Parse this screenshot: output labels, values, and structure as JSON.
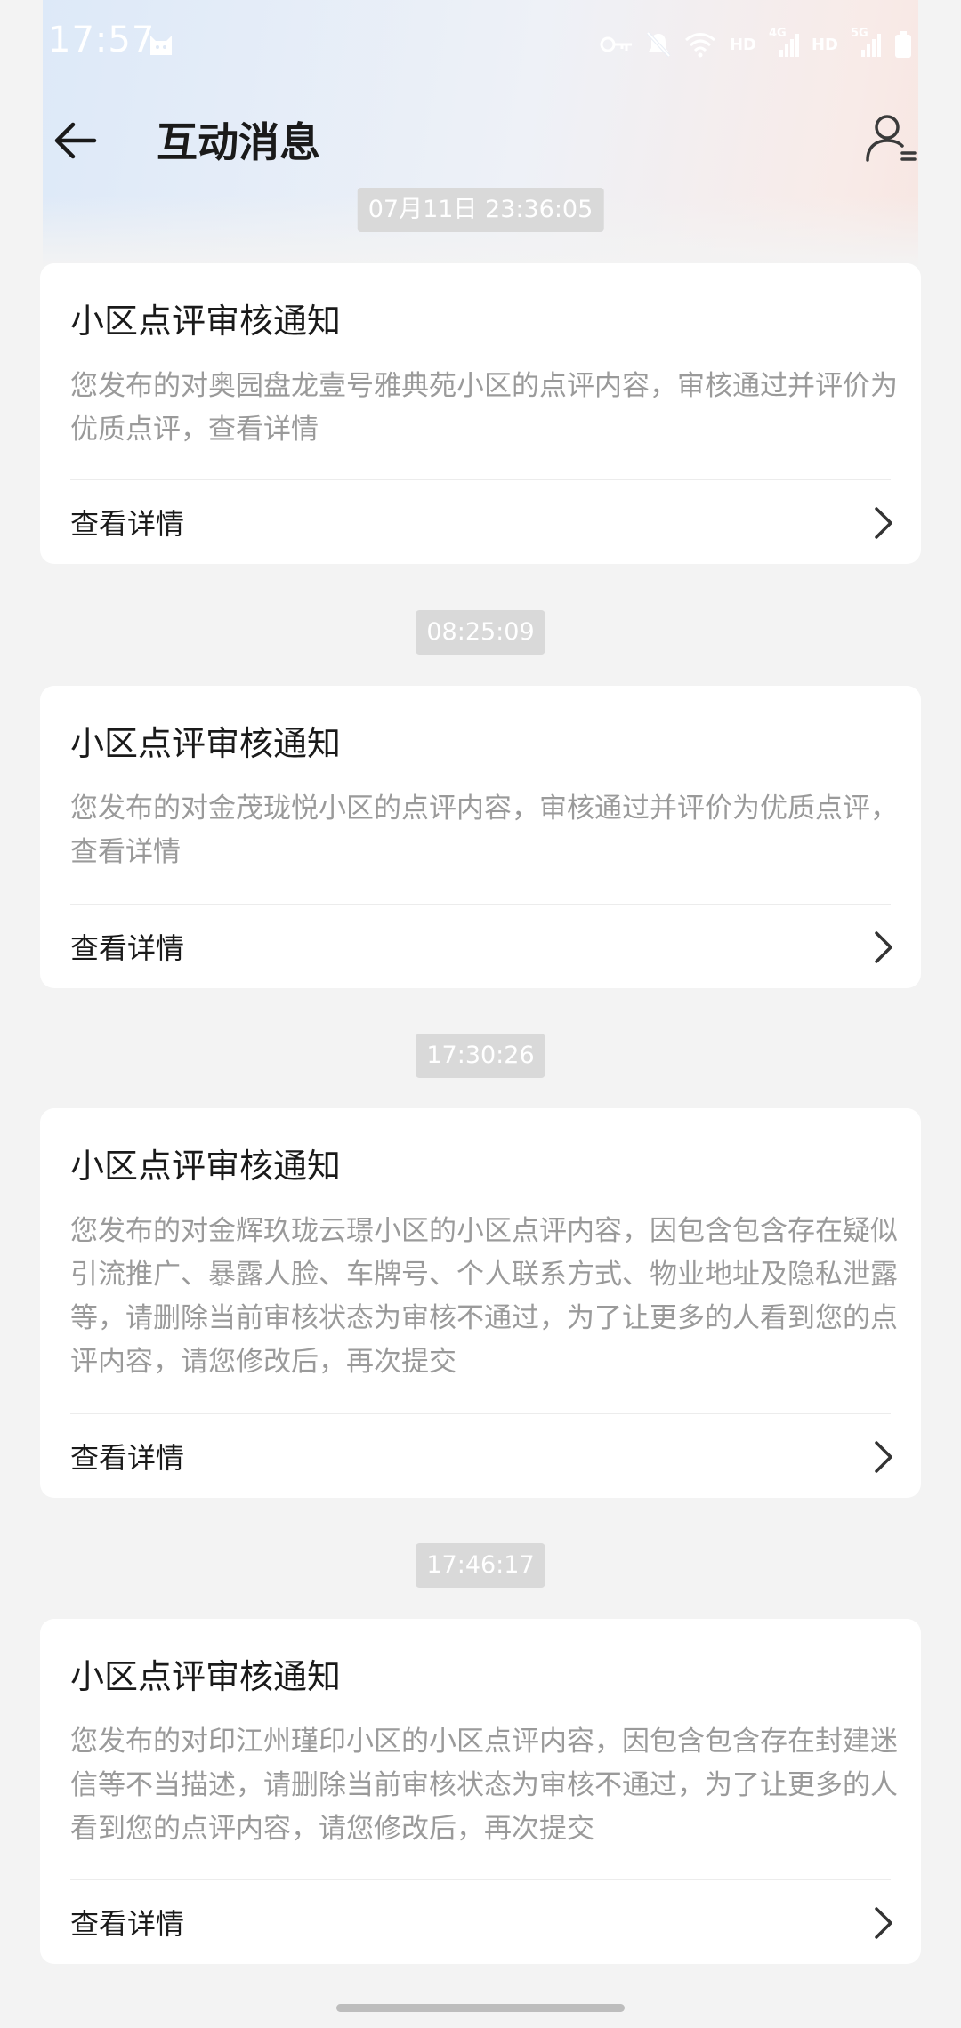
{
  "status_bar": {
    "time": "17:57",
    "indicators": [
      "HD",
      "4G",
      "HD",
      "5G"
    ],
    "icons": [
      "cat-icon",
      "key-icon",
      "mute-icon",
      "wifi-icon",
      "signal-icon",
      "battery-icon"
    ]
  },
  "header": {
    "title": "互动消息",
    "back_icon": "arrow-left-icon",
    "user_icon": "user-list-icon"
  },
  "messages": [
    {
      "timestamp": "07月11日 23:36:05",
      "title": "小区点评审核通知",
      "body": "您发布的对奥园盘龙壹号雅典苑小区的点评内容，审核通过并评价为优质点评，查看详情",
      "action": "查看详情"
    },
    {
      "timestamp": "08:25:09",
      "title": "小区点评审核通知",
      "body": "您发布的对金茂珑悦小区的点评内容，审核通过并评价为优质点评，查看详情",
      "action": "查看详情"
    },
    {
      "timestamp": "17:30:26",
      "title": "小区点评审核通知",
      "body": "您发布的对金辉玖珑云璟小区的小区点评内容，因包含包含存在疑似引流推广、暴露人脸、车牌号、个人联系方式、物业地址及隐私泄露等，请删除当前审核状态为审核不通过，为了让更多的人看到您的点评内容，请您修改后，再次提交",
      "action": "查看详情"
    },
    {
      "timestamp": "17:46:17",
      "title": "小区点评审核通知",
      "body": "您发布的对印江州瑾印小区的小区点评内容，因包含包含存在封建迷信等不当描述，请删除当前审核状态为审核不通过，为了让更多的人看到您的点评内容，请您修改后，再次提交",
      "action": "查看详情"
    }
  ]
}
